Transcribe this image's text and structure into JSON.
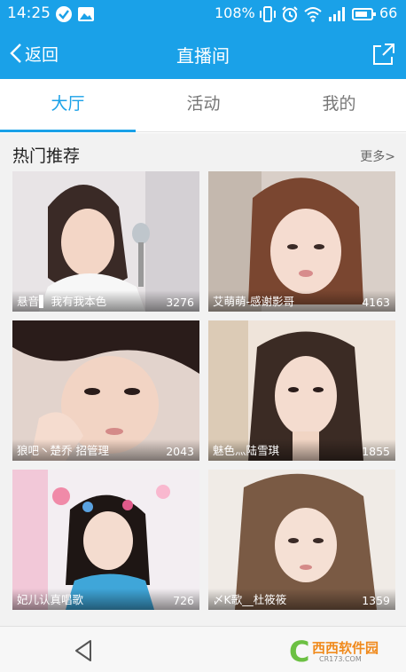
{
  "status_bar": {
    "time": "14:25",
    "battery_percent": "108%",
    "battery_level": "66",
    "icons": [
      "check-circle-icon",
      "image-icon",
      "vibrate-icon",
      "alarm-icon",
      "wifi-icon",
      "signal-icon",
      "battery-icon"
    ]
  },
  "header": {
    "back_label": "返回",
    "title": "直播间",
    "share_icon": "share-icon"
  },
  "tabs": [
    {
      "label": "大厅",
      "active": true
    },
    {
      "label": "活动",
      "active": false
    },
    {
      "label": "我的",
      "active": false
    }
  ],
  "section": {
    "title": "热门推荐",
    "more": "更多>"
  },
  "rooms": [
    {
      "name": "悬音▌ 我有我本色",
      "viewers": "3276"
    },
    {
      "name": "艾萌萌-感谢影哥",
      "viewers": "4163"
    },
    {
      "name": "狼吧丶楚乔 招管理",
      "viewers": "2043"
    },
    {
      "name": "魅色灬陆雪琪",
      "viewers": "1855"
    },
    {
      "name": "妃儿认真唱歌",
      "viewers": "726"
    },
    {
      "name": "〆K歌__杜筱筱",
      "viewers": "1359"
    }
  ],
  "nav": {
    "back_icon": "triangle-back-icon"
  },
  "watermark": {
    "brand": "西西软件园",
    "url": "CR173.COM"
  },
  "colors": {
    "accent": "#1aa1e8",
    "watermark_green": "#6cc043",
    "watermark_orange": "#f08a1c"
  }
}
